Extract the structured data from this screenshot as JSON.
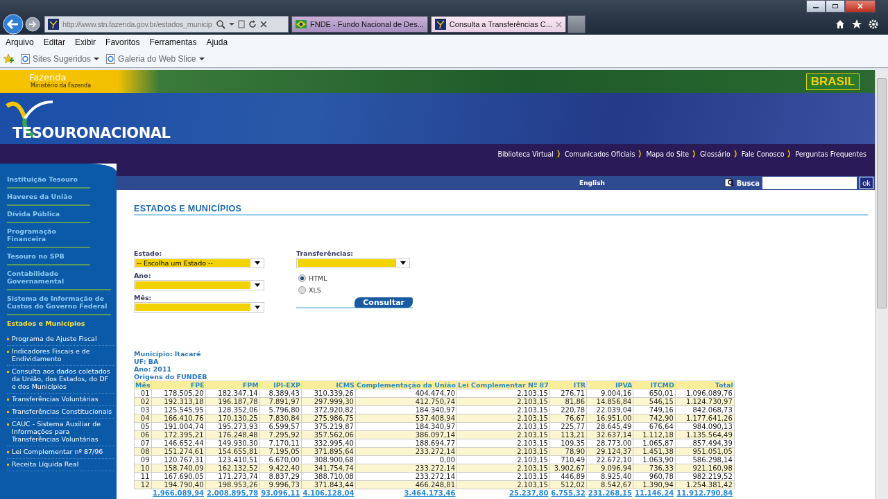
{
  "browser": {
    "address": "http://www.stn.fazenda.gov.br/estados_municip",
    "tabs": [
      {
        "title": "FNDE - Fundo Nacional de Des...",
        "selected": false
      },
      {
        "title": "Consulta a Transferências C...",
        "selected": true
      }
    ],
    "menu": [
      "Arquivo",
      "Editar",
      "Exibir",
      "Favoritos",
      "Ferramentas",
      "Ajuda"
    ],
    "favorites": [
      "Sites Sugeridos",
      "Galeria do Web Slice"
    ]
  },
  "header": {
    "ministry": "Fazenda",
    "ministry_sub": "Ministério da Fazenda",
    "brand": "BRASIL",
    "logo": "TESOURONACIONAL",
    "links": [
      "Biblioteca Virtual",
      "Comunicados Oficiais",
      "Mapa do Site",
      "Glossário",
      "Fale Conosco",
      "Perguntas Frequentes"
    ],
    "language": "English",
    "search_label": "Busca",
    "search_button": "ok"
  },
  "sidebar": {
    "items": [
      {
        "label": "Instituição Tesouro",
        "selected": false
      },
      {
        "label": "Haveres da União",
        "selected": false
      },
      {
        "label": "Dívida Pública",
        "selected": false
      },
      {
        "label": "Programação Financeira",
        "selected": false
      },
      {
        "label": "Tesouro no SPB",
        "selected": false
      },
      {
        "label": "Contabilidade Governamental",
        "selected": false
      },
      {
        "label": "Sistema de Informação de Custos do Governo Federal",
        "selected": false
      },
      {
        "label": "Estados e Municípios",
        "selected": true,
        "children": [
          {
            "label": "Programa de Ajuste Fiscal"
          },
          {
            "label": "Indicadores Fiscais e de Endividamento"
          },
          {
            "label": "Consulta aos dados coletados da União, dos Estados, do DF e dos Municípios"
          },
          {
            "label": "Transferências Voluntárias"
          },
          {
            "label": "Transferências Constitucionais"
          },
          {
            "label": "CAUC - Sistema Auxiliar de Informações para Transferências Voluntárias"
          },
          {
            "label": "Lei Complementar nº 87/96"
          },
          {
            "label": "Receita Líquida Real"
          }
        ]
      }
    ]
  },
  "content": {
    "title": "ESTADOS E MUNICÍPIOS",
    "fields": [
      {
        "label": "Estado:",
        "value": "-- Escolha um Estado --"
      },
      {
        "label": "Ano:"
      },
      {
        "label": "Mês:"
      }
    ],
    "transfer_field": {
      "label": "Transferências:"
    },
    "formats": [
      {
        "label": "HTML",
        "selected": true
      },
      {
        "label": "XLS",
        "selected": false
      }
    ],
    "submit": "Consultar",
    "info": [
      "Município: Itacaré",
      "UF: BA",
      "Ano: 2011",
      "Origens do FUNDEB"
    ],
    "table": {
      "columns": [
        "Mês",
        "FPE",
        "FPM",
        "IPI-EXP",
        "ICMS",
        "Complementação da União",
        "Lei Complementar Nº 87",
        "ITR",
        "IPVA",
        "ITCMD",
        "Total"
      ],
      "rows": [
        [
          "01",
          "178.505,20",
          "182.347,14",
          "8.389,43",
          "310.339,26",
          "404.474,70",
          "2.103,15",
          "276,71",
          "9.004,16",
          "650,01",
          "1.096.089,76"
        ],
        [
          "02",
          "192.313,18",
          "196.187,78",
          "7.891,97",
          "297.999,30",
          "412.750,74",
          "2.103,15",
          "81,86",
          "14.856,84",
          "546,15",
          "1.124.730,97"
        ],
        [
          "03",
          "125.545,95",
          "128.352,06",
          "5.796,80",
          "372.920,82",
          "184.340,97",
          "2.103,15",
          "220,78",
          "22.039,04",
          "749,16",
          "842.068,73"
        ],
        [
          "04",
          "166.410,76",
          "170.130,25",
          "7.830,84",
          "275.986,75",
          "537.408,94",
          "2.103,15",
          "76,67",
          "16.951,00",
          "742,90",
          "1.177.641,26"
        ],
        [
          "05",
          "191.004,74",
          "195.273,93",
          "6.599,57",
          "375.219,87",
          "184.340,97",
          "2.103,15",
          "225,77",
          "28.645,49",
          "676,64",
          "984.090,13"
        ],
        [
          "06",
          "172.395,21",
          "176.248,48",
          "7.295,92",
          "357.562,06",
          "386.097,14",
          "2.103,15",
          "113,21",
          "32.637,14",
          "1.112,18",
          "1.135.564,49"
        ],
        [
          "07",
          "146.652,44",
          "149.930,30",
          "7.170,11",
          "332.995,40",
          "188.694,77",
          "2.103,15",
          "109,35",
          "28.773,00",
          "1.065,87",
          "857.494,39"
        ],
        [
          "08",
          "151.274,61",
          "154.655,81",
          "7.195,05",
          "371.895,64",
          "233.272,14",
          "2.103,15",
          "78,90",
          "29.124,37",
          "1.451,38",
          "951.051,05"
        ],
        [
          "09",
          "120.767,31",
          "123.410,51",
          "6.670,00",
          "308.900,68",
          "0,00",
          "2.103,15",
          "710,49",
          "22.672,10",
          "1.063,90",
          "586.298,14"
        ],
        [
          "10",
          "158.740,09",
          "162.132,52",
          "9.422,40",
          "341.754,74",
          "233.272,14",
          "2.103,15",
          "3.902,67",
          "9.096,94",
          "736,33",
          "921.160,98"
        ],
        [
          "11",
          "167.690,05",
          "171.273,74",
          "8.837,29",
          "388.710,08",
          "233.272,14",
          "2.103,15",
          "446,89",
          "8.925,40",
          "960,78",
          "982.219,52"
        ],
        [
          "12",
          "194.790,40",
          "198.953,26",
          "9.996,73",
          "371.843,44",
          "466.248,81",
          "2.103,15",
          "512,02",
          "8.542,67",
          "1.390,94",
          "1.254.381,42"
        ]
      ],
      "totals": [
        "1.966.089,94",
        "2.008.895,78",
        "93.096,11",
        "4.106.128,04",
        "3.464.173,46",
        "25.237,80",
        "6.755,32",
        "231.268,15",
        "11.146,24",
        "11.912.790,84"
      ]
    }
  }
}
